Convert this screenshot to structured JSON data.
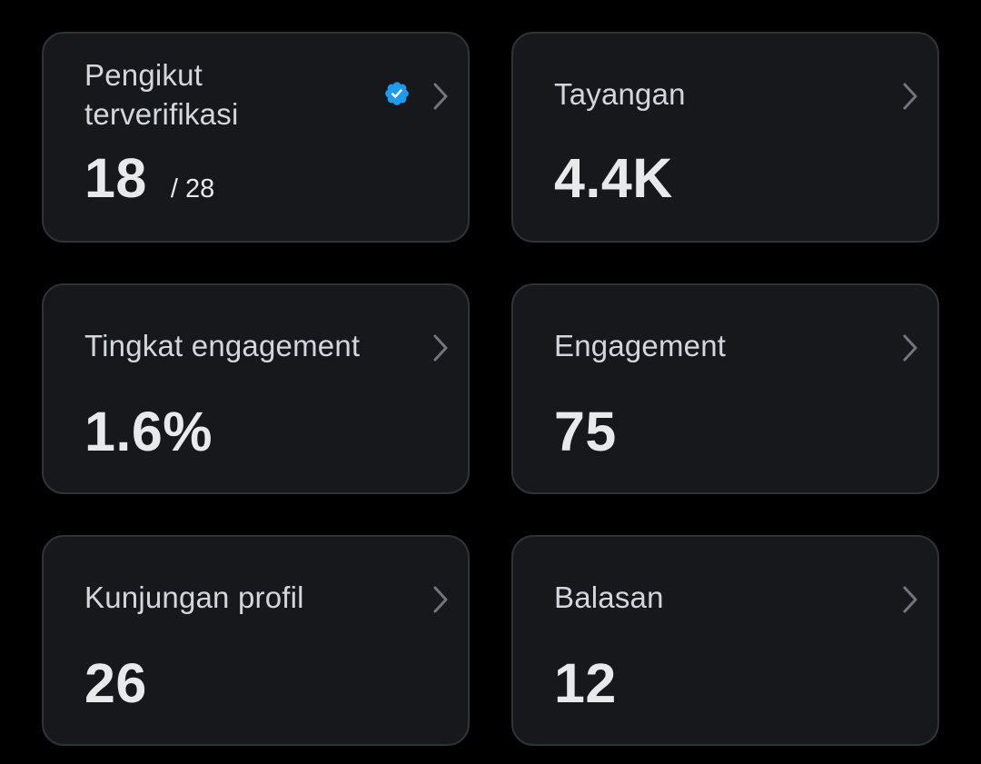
{
  "colors": {
    "background": "#000000",
    "card_bg": "#16181c",
    "card_border": "#2f3336",
    "title_text": "#d3d6da",
    "value_text": "#e7e9ea",
    "chevron": "#71767b",
    "verified_badge": "#1d9bf0"
  },
  "cards": [
    {
      "title_line1": "Pengikut",
      "title_line2": "terverifikasi",
      "icon": "verified-badge-icon",
      "value": "18",
      "sub_value": "/ 28"
    },
    {
      "title": "Tayangan",
      "value": "4.4K"
    },
    {
      "title": "Tingkat engagement",
      "value": "1.6%"
    },
    {
      "title": "Engagement",
      "value": "75"
    },
    {
      "title": "Kunjungan profil",
      "value": "26"
    },
    {
      "title": "Balasan",
      "value": "12"
    }
  ]
}
